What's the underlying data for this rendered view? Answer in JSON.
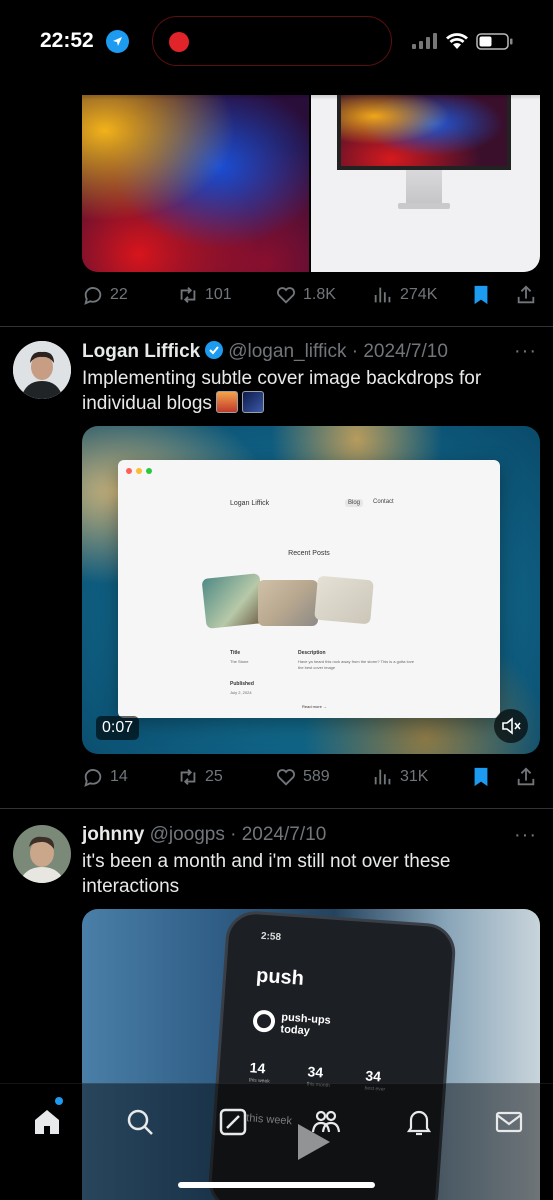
{
  "status_bar": {
    "time": "22:52",
    "icons": [
      "location-arrow-icon",
      "recording-dot-icon",
      "signal-icon",
      "wifi-icon",
      "battery-icon"
    ]
  },
  "colors": {
    "background": "#000000",
    "accent": "#1d9bf0",
    "text_primary": "#e7e9ea",
    "text_secondary": "#71767b",
    "recording": "#e0242a"
  },
  "tweets": [
    {
      "actions": {
        "replies": "22",
        "retweets": "101",
        "likes": "1.8K",
        "views": "274K"
      }
    },
    {
      "name": "Logan Liffick",
      "verified": true,
      "handle": "@logan_liffick",
      "date": "2024/7/10",
      "text": "Implementing subtle cover image backdrops for individual blogs",
      "video": {
        "duration": "0:07",
        "browser_site_name": "Logan Liffick",
        "browser_nav": [
          "Blog",
          "Contact"
        ],
        "browser_heading": "Recent Posts",
        "browser_title_label": "Title",
        "browser_title_value": "The Stone",
        "browser_published_label": "Published",
        "browser_published_value": "July 2, 2024",
        "browser_description_label": "Description",
        "browser_description_value": "Have ya heard this rock away from the storm? This is a gotta love the best cover image",
        "browser_read_more": "Read more →"
      },
      "actions": {
        "replies": "14",
        "retweets": "25",
        "likes": "589",
        "views": "31K"
      }
    },
    {
      "name": "johnny",
      "handle": "@joogps",
      "date": "2024/7/10",
      "text": "it's been a month and i'm still not over these interactions",
      "phone": {
        "time": "2:58",
        "app_title": "push",
        "subtitle": "push-ups today",
        "stats": [
          "14",
          "34",
          "34"
        ],
        "stat_labels": [
          "this week",
          "this month",
          "best ever"
        ],
        "week_label": "this week"
      }
    }
  ],
  "tab_bar": {
    "items": [
      "home-icon",
      "search-icon",
      "grok-icon",
      "communities-icon",
      "notifications-icon",
      "messages-icon"
    ]
  }
}
